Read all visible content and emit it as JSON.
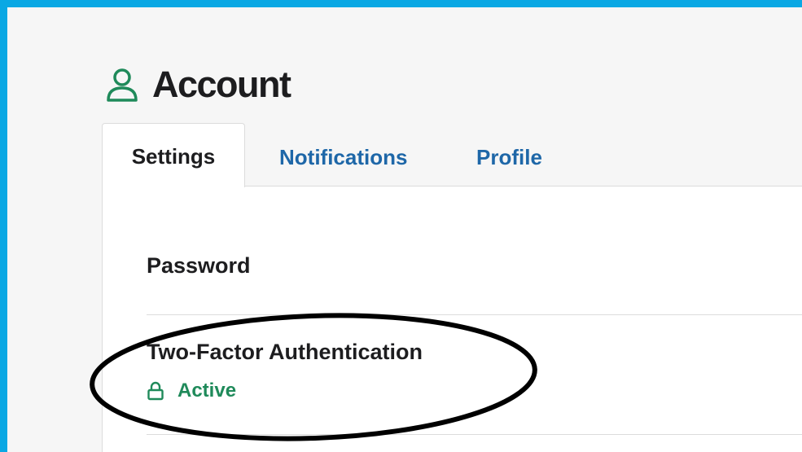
{
  "header": {
    "title": "Account",
    "icon": "user-icon",
    "accent_color": "#1f8a5a"
  },
  "tabs": [
    {
      "label": "Settings",
      "active": true
    },
    {
      "label": "Notifications",
      "active": false
    },
    {
      "label": "Profile",
      "active": false
    }
  ],
  "settings": {
    "password": {
      "title": "Password"
    },
    "two_factor": {
      "title": "Two-Factor Authentication",
      "status": "Active",
      "status_icon": "lock-icon",
      "status_color": "#1f8a5a"
    }
  },
  "colors": {
    "frame_border": "#0aa8e4",
    "tab_link": "#1e67a8",
    "text": "#1d1d1f"
  }
}
